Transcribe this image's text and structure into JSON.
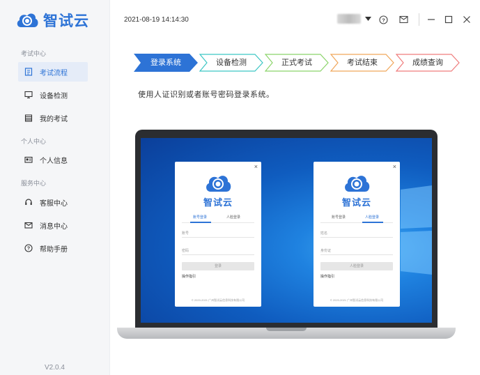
{
  "app": {
    "name": "智试云",
    "version": "V2.0.4",
    "brand_color": "#2d73d6"
  },
  "header": {
    "datetime": "2021-08-19 14:14:30",
    "icons": [
      "chevron-down-icon",
      "help-icon",
      "mail-icon",
      "minimize-icon",
      "maximize-icon",
      "close-icon"
    ]
  },
  "sidebar": {
    "sections": [
      {
        "title": "考试中心",
        "items": [
          {
            "label": "考试流程",
            "icon": "list-icon",
            "active": true
          },
          {
            "label": "设备检测",
            "icon": "monitor-icon",
            "active": false
          },
          {
            "label": "我的考试",
            "icon": "calendar-icon",
            "active": false
          }
        ]
      },
      {
        "title": "个人中心",
        "items": [
          {
            "label": "个人信息",
            "icon": "id-card-icon",
            "active": false
          }
        ]
      },
      {
        "title": "服务中心",
        "items": [
          {
            "label": "客服中心",
            "icon": "headset-icon",
            "active": false
          },
          {
            "label": "消息中心",
            "icon": "mail-icon",
            "active": false
          },
          {
            "label": "帮助手册",
            "icon": "help-icon",
            "active": false
          }
        ]
      }
    ]
  },
  "steps": [
    {
      "label": "登录系统",
      "active": true,
      "color": "#2d73d6"
    },
    {
      "label": "设备检测",
      "active": false,
      "color": "#3cc6c4"
    },
    {
      "label": "正式考试",
      "active": false,
      "color": "#8bd46a"
    },
    {
      "label": "考试结束",
      "active": false,
      "color": "#f0a65a"
    },
    {
      "label": "成绩查询",
      "active": false,
      "color": "#ef7c7c"
    }
  ],
  "instruction": "使用人证识别或者账号密码登录系统。",
  "laptop_screen": {
    "dialogs": [
      {
        "name": "智试云",
        "close": "×",
        "tabs": [
          "账号登录",
          "人脸登录"
        ],
        "active_tab": 0,
        "fields": [
          "账号",
          "密码"
        ],
        "button": "登录",
        "help": "操作指引",
        "copyright": "© 2020-2021 广州智试云信息科技有限公司"
      },
      {
        "name": "智试云",
        "close": "×",
        "tabs": [
          "账号登录",
          "人脸登录"
        ],
        "active_tab": 1,
        "fields": [
          "姓名",
          "身份证"
        ],
        "button": "人脸登录",
        "help": "操作指引",
        "copyright": "© 2020-2021 广州智试云信息科技有限公司"
      }
    ]
  }
}
